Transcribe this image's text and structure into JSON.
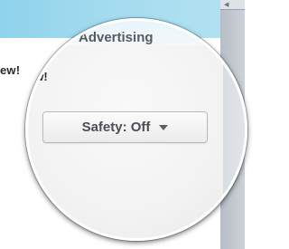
{
  "header": {
    "title": "Advertising",
    "edge_text": "ew!"
  },
  "controls": {
    "safety_label": "Safety: Off"
  },
  "icons": {
    "dropdown": "chevron-down-icon",
    "corner": "chevron-left-icon"
  },
  "colors": {
    "accent_blue": "#8fd3ec",
    "button_border": "#b9b9b9",
    "label_gray": "#555a61"
  }
}
